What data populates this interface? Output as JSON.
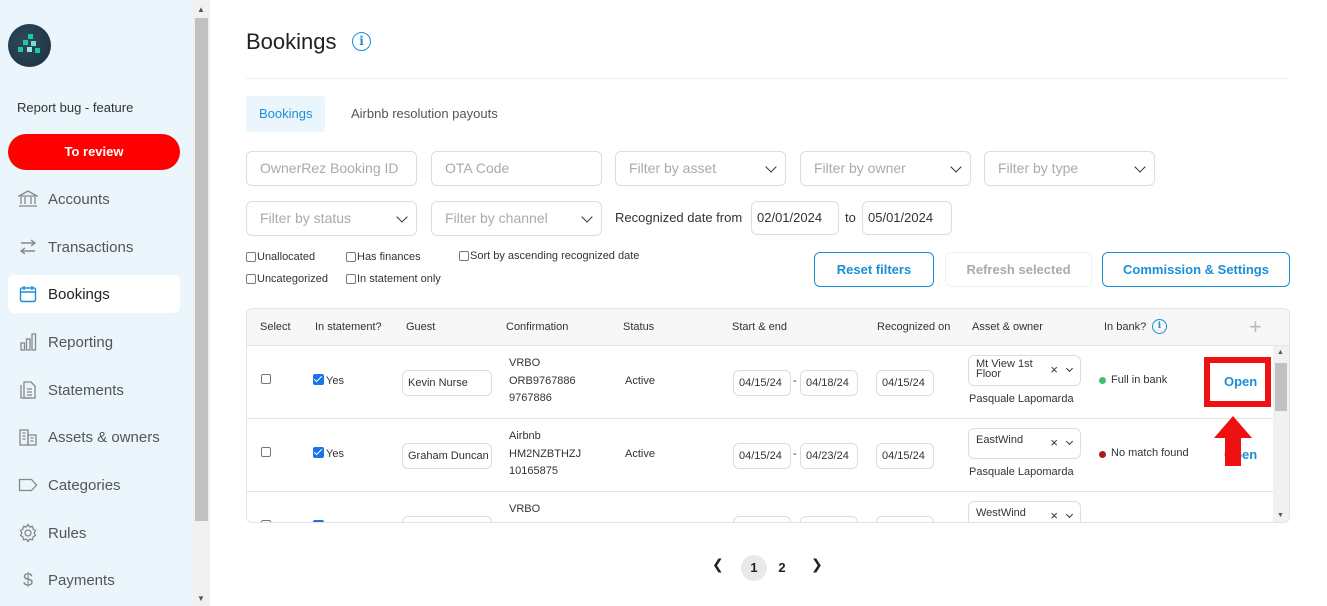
{
  "sidebar": {
    "report_link": "Report bug - feature",
    "review_button": "To review",
    "items": [
      {
        "label": "Accounts",
        "icon": "bank-icon"
      },
      {
        "label": "Transactions",
        "icon": "transfer-icon"
      },
      {
        "label": "Bookings",
        "icon": "calendar-icon",
        "active": true
      },
      {
        "label": "Reporting",
        "icon": "bar-chart-icon"
      },
      {
        "label": "Statements",
        "icon": "document-icon"
      },
      {
        "label": "Assets & owners",
        "icon": "building-icon"
      },
      {
        "label": "Categories",
        "icon": "tag-icon"
      },
      {
        "label": "Rules",
        "icon": "gear-icon"
      },
      {
        "label": "Payments",
        "icon": "dollar-icon"
      }
    ]
  },
  "page": {
    "title": "Bookings",
    "info_glyph": "i"
  },
  "tabs": [
    {
      "label": "Bookings",
      "active": true
    },
    {
      "label": "Airbnb resolution payouts",
      "active": false
    }
  ],
  "filters": {
    "ownerrez_placeholder": "OwnerRez Booking ID",
    "ota_placeholder": "OTA Code",
    "asset": "Filter by asset",
    "owner": "Filter by owner",
    "type": "Filter by type",
    "status": "Filter by status",
    "channel": "Filter by channel",
    "date_label": "Recognized date from",
    "date_from": "02/01/2024",
    "date_to_label": "to",
    "date_to": "05/01/2024"
  },
  "checkboxes": {
    "unallocated": "Unallocated",
    "has_finances": "Has finances",
    "sort_asc": "Sort by ascending recognized date",
    "uncategorized": "Uncategorized",
    "in_statement_only": "In statement only"
  },
  "buttons": {
    "reset": "Reset filters",
    "refresh": "Refresh selected",
    "commission": "Commission & Settings"
  },
  "table": {
    "headers": {
      "select": "Select",
      "in_statement": "In statement?",
      "guest": "Guest",
      "confirmation": "Confirmation",
      "status": "Status",
      "start_end": "Start & end",
      "recognized_on": "Recognized on",
      "asset_owner": "Asset & owner",
      "in_bank": "In bank?",
      "plus": "+"
    },
    "rows": [
      {
        "in_statement": "Yes",
        "guest": "Kevin Nurse",
        "conf1": "VRBO",
        "conf2": "ORB9767886",
        "conf3": "9767886",
        "status": "Active",
        "start": "04/15/24",
        "sep": "-",
        "end": "04/18/24",
        "recognized": "04/15/24",
        "asset": "Mt View 1st Floor",
        "x": "×",
        "owner": "Pasquale Lapomarda",
        "bank": "Full in bank",
        "bank_color": "#3cc46a",
        "action": "Open"
      },
      {
        "in_statement": "Yes",
        "guest": "Graham Duncan",
        "conf1": "Airbnb",
        "conf2": "HM2NZBTHZJ",
        "conf3": "10165875",
        "status": "Active",
        "start": "04/15/24",
        "sep": "-",
        "end": "04/23/24",
        "recognized": "04/15/24",
        "asset": "EastWind",
        "x": "×",
        "owner": "Pasquale Lapomarda",
        "bank": "No match found",
        "bank_color": "#a61c1c",
        "action": "Open"
      },
      {
        "conf1": "VRBO",
        "asset": "WestWind",
        "x": "×"
      }
    ]
  },
  "pagination": {
    "prev": "❮",
    "pages": [
      "1",
      "2"
    ],
    "next": "❯"
  },
  "annotation": {
    "box_color": "#ee1111"
  }
}
